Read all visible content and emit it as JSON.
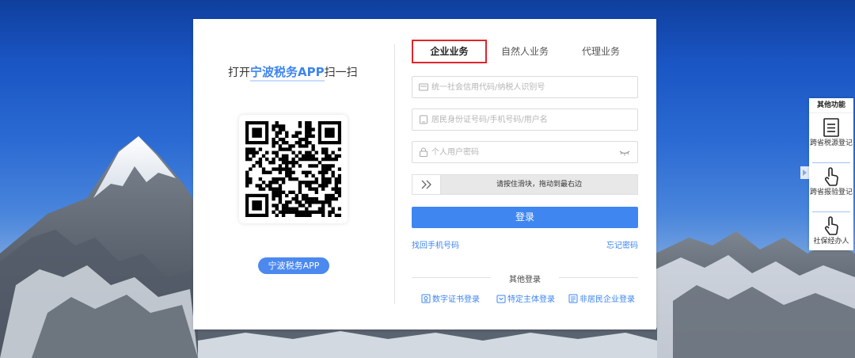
{
  "login": {
    "scan": {
      "prefix": "打开",
      "brand": "宁波税务APP",
      "suffix": "扫一扫"
    },
    "app_button": "宁波税务APP",
    "tabs": [
      {
        "label": "企业业务",
        "active": true
      },
      {
        "label": "自然人业务",
        "active": false
      },
      {
        "label": "代理业务",
        "active": false
      }
    ],
    "fields": {
      "credit_code_placeholder": "统一社会信用代码/纳税人识别号",
      "id_placeholder": "居民身份证号码/手机号码/用户名",
      "password_placeholder": "个人用户密码"
    },
    "slider_text": "请按住滑块，拖动到最右边",
    "login_button": "登录",
    "links": {
      "find_phone": "找回手机号码",
      "forgot_password": "忘记密码"
    },
    "other_login": {
      "title": "其他登录",
      "options": [
        "数字证书登录",
        "特定主体登录",
        "非居民企业登录"
      ]
    }
  },
  "side_panel": {
    "title": "其他功能",
    "items": [
      "跨省税源登记",
      "跨省报验登记",
      "社保经办人"
    ]
  },
  "colors": {
    "primary": "#3f86f1",
    "active_tab_border": "#e0252b"
  }
}
